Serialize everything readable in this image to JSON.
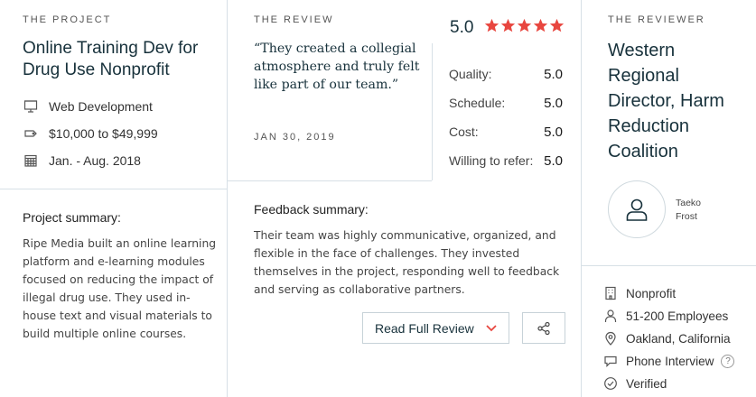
{
  "project": {
    "eyebrow": "THE PROJECT",
    "title": "Online Training Dev for Drug Use Nonprofit",
    "service": "Web Development",
    "budget": "$10,000 to $49,999",
    "timeline": "Jan. - Aug. 2018",
    "summary_heading": "Project summary:",
    "summary": "Ripe Media built an online learning platform and e-learning modules focused on reducing the impact of illegal drug use. They used in-house text and visual materials to build multiple online courses."
  },
  "review": {
    "eyebrow": "THE REVIEW",
    "quote": "“They created a collegial atmosphere and truly felt like part of our team.”",
    "date": "JAN 30, 2019",
    "overall": "5.0",
    "stars": 5,
    "ratings": [
      {
        "label": "Quality:",
        "value": "5.0"
      },
      {
        "label": "Schedule:",
        "value": "5.0"
      },
      {
        "label": "Cost:",
        "value": "5.0"
      },
      {
        "label": "Willing to refer:",
        "value": "5.0"
      }
    ],
    "feedback_heading": "Feedback summary:",
    "feedback": "Their team was highly communicative, organized, and flexible in the face of challenges. They invested themselves in the project, responding well to feedback and serving as collaborative partners.",
    "read_button": "Read Full Review"
  },
  "reviewer": {
    "eyebrow": "THE REVIEWER",
    "title": "Western Regional Director, Harm Reduction Coalition",
    "name_first": "Taeko",
    "name_last": "Frost",
    "industry": "Nonprofit",
    "size": "51-200 Employees",
    "location": "Oakland, California",
    "method": "Phone Interview",
    "verified": "Verified",
    "help": "?"
  },
  "colors": {
    "accent": "#e8463f",
    "heading": "#17313b",
    "divider": "#d7e0e6"
  }
}
